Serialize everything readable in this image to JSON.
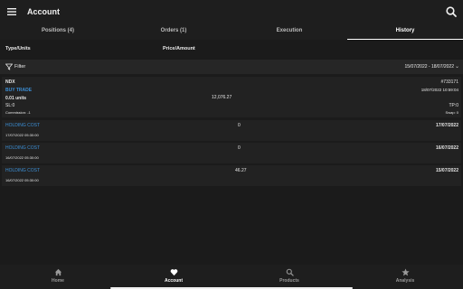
{
  "header": {
    "title": "Account"
  },
  "tabs": [
    {
      "label": "Positions (4)"
    },
    {
      "label": "Orders (1)"
    },
    {
      "label": "Execution"
    },
    {
      "label": "History"
    }
  ],
  "columns": {
    "type_units": "Type/Units",
    "price_amount": "Price/Amount"
  },
  "filter": {
    "label": "Filter",
    "date_range": "15/07/2022 - 18/07/2022"
  },
  "trade": {
    "symbol": "NDX",
    "id": "#733171",
    "type": "BUY TRADE",
    "datetime": "18/07/2022 10:59:04",
    "units": "0.01 units",
    "price": "12,076.27",
    "sl": "SL:0",
    "tp": "TP:0",
    "commission": "Commission: -1",
    "swap": "Swap: 0"
  },
  "holding_costs": [
    {
      "label": "HOLDING COST",
      "amount": "0",
      "date": "17/07/2022",
      "datetime": "17/07/2022 05:30:00"
    },
    {
      "label": "HOLDING COST",
      "amount": "0",
      "date": "16/07/2022",
      "datetime": "16/07/2022 05:30:00"
    },
    {
      "label": "HOLDING COST",
      "amount": "46.27",
      "date": "15/07/2022",
      "datetime": "16/07/2022 05:30:00"
    }
  ],
  "bottom_nav": [
    {
      "label": "Home",
      "icon": "home-icon"
    },
    {
      "label": "Account",
      "icon": "heart-icon"
    },
    {
      "label": "Products",
      "icon": "search-icon"
    },
    {
      "label": "Analysis",
      "icon": "star-icon"
    }
  ],
  "colors": {
    "accent_blue": "#3c8fd6",
    "background": "#1b1b1b"
  }
}
